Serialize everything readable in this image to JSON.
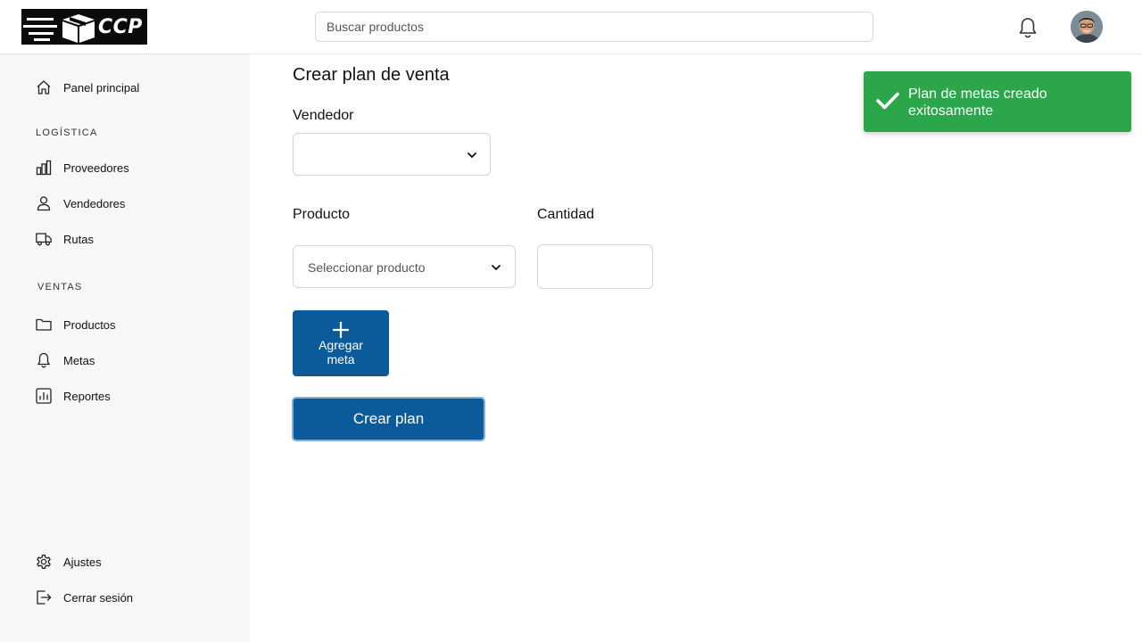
{
  "header": {
    "logo_text": "CCP",
    "search_placeholder": "Buscar productos",
    "notifications_icon": "bell-icon",
    "avatar_icon": "user-avatar"
  },
  "sidebar": {
    "home": {
      "label": "Panel principal",
      "icon": "home-icon"
    },
    "logistics_section": "LOGÍSTICA",
    "logistics_items": [
      {
        "label": "Proveedores",
        "icon": "bar-chart-icon"
      },
      {
        "label": "Vendedores",
        "icon": "user-icon"
      },
      {
        "label": "Rutas",
        "icon": "truck-icon"
      }
    ],
    "sales_section": "VENTAS",
    "sales_items": [
      {
        "label": "Productos",
        "icon": "folder-icon"
      },
      {
        "label": "Metas",
        "icon": "bell-icon"
      },
      {
        "label": "Reportes",
        "icon": "report-chart-icon"
      }
    ],
    "footer_items": [
      {
        "label": "Ajustes",
        "icon": "gear-icon"
      },
      {
        "label": "Cerrar sesión",
        "icon": "logout-icon"
      }
    ]
  },
  "main": {
    "title": "Crear plan de venta",
    "seller_label": "Vendedor",
    "seller_value": "",
    "product_label": "Producto",
    "product_placeholder": "Seleccionar producto",
    "quantity_label": "Cantidad",
    "quantity_value": "",
    "add_goal_button_line1": "Agregar",
    "add_goal_button_line2": "meta",
    "create_plan_button": "Crear plan"
  },
  "toast": {
    "message_line1": "Plan de metas creado",
    "message_line2": "exitosamente",
    "icon": "check-icon",
    "color": "#2ba64a"
  },
  "colors": {
    "primary": "#0b5a99",
    "sidebar_bg": "#f7f7f7",
    "success": "#2ba64a"
  }
}
